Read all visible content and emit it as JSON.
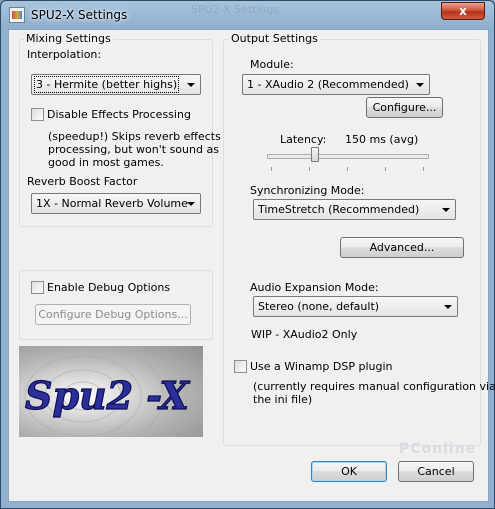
{
  "window": {
    "title": "SPU2-X Settings",
    "ghost_title": "SPU2-X Settings",
    "close_glyph": "x"
  },
  "mixing": {
    "group_label": "Mixing Settings",
    "interpolation_label": "Interpolation:",
    "interpolation_value": "3 - Hermite (better highs)",
    "disable_effects_label": "Disable Effects Processing",
    "disable_effects_checked": false,
    "effects_desc": [
      "(speedup!) Skips reverb effects",
      "processing, but won't sound as",
      "good in most games."
    ],
    "reverb_label": "Reverb Boost Factor",
    "reverb_value": "1X - Normal Reverb Volume"
  },
  "debug": {
    "enable_label": "Enable Debug Options",
    "enable_checked": false,
    "configure_label": "Configure Debug Options..."
  },
  "output": {
    "group_label": "Output Settings",
    "module_label": "Module:",
    "module_value": "1 - XAudio 2 (Recommended)",
    "configure_label": "Configure...",
    "latency_label": "Latency:",
    "latency_value": "150 ms (avg)",
    "latency_slider_fraction": 0.3,
    "sync_label": "Synchronizing Mode:",
    "sync_value": "TimeStretch (Recommended)",
    "advanced_label": "Advanced...",
    "expansion_label": "Audio Expansion Mode:",
    "expansion_value": "Stereo (none, default)",
    "wip_note": "WIP - XAudio2 Only",
    "winamp_label": "Use a Winamp DSP plugin",
    "winamp_checked": false,
    "winamp_desc": [
      "(currently requires manual configuration via",
      "the ini file)"
    ]
  },
  "logo": {
    "text": "Spu2 -X"
  },
  "footer": {
    "ok_label": "OK",
    "cancel_label": "Cancel"
  },
  "watermark": "PConline",
  "icons": {
    "app": "app-icon",
    "close": "close-icon",
    "dropdown": "chevron-down-icon"
  },
  "colors": {
    "close_button": "#c8452c",
    "client_bg": "#f0f0f0",
    "frame": "#8fb0d0",
    "logo_text": "#2c2f9a"
  }
}
